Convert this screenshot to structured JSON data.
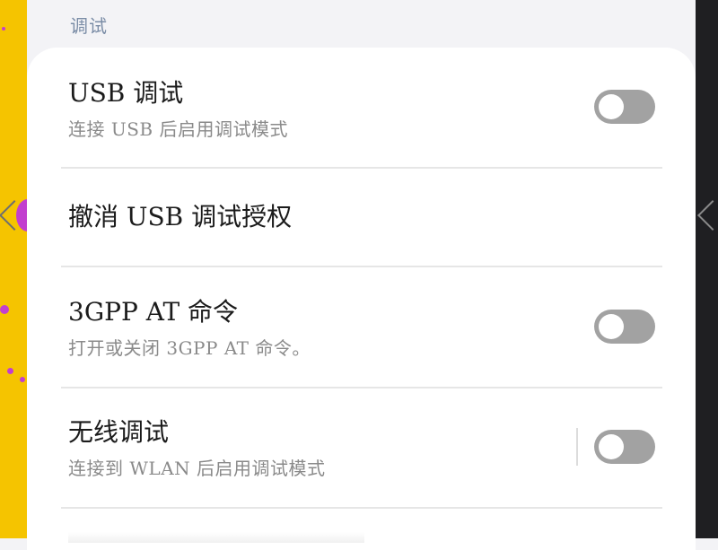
{
  "section": {
    "title": "调试"
  },
  "items": [
    {
      "title": "USB 调试",
      "subtitle": "连接 USB 后启用调试模式",
      "toggle_on": false
    },
    {
      "title": "撤消 USB 调试授权"
    },
    {
      "title": "3GPP AT 命令",
      "subtitle": "打开或关闭 3GPP AT 命令。",
      "toggle_on": false
    },
    {
      "title": "无线调试",
      "subtitle": "连接到 WLAN 后启用调试模式",
      "toggle_on": false
    }
  ],
  "colors": {
    "wallpaper_left": "#f5c400",
    "wallpaper_dots": "#c23fcf",
    "toggle_off": "#a2a2a2",
    "section_header": "#7a8ca6"
  }
}
